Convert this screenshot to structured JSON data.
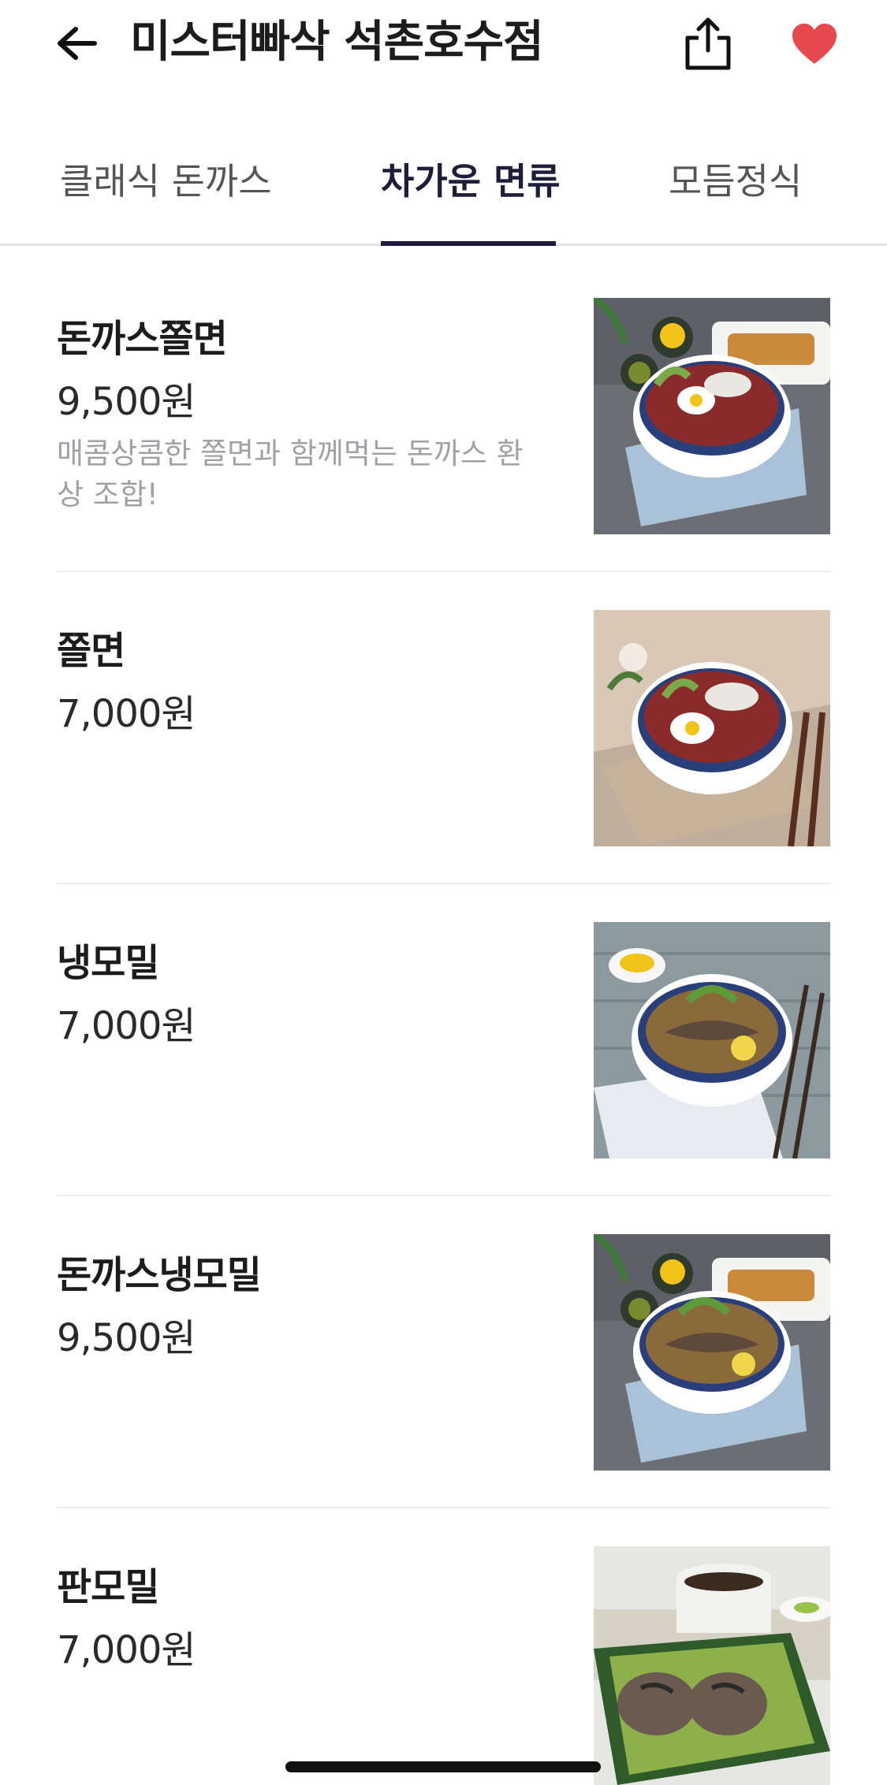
{
  "header": {
    "title": "미스터빠삭 석촌호수점",
    "back_icon": "arrow-left-icon",
    "share_icon": "share-icon",
    "favorite_icon": "heart-icon",
    "favorite_color": "#e5484d"
  },
  "tabs": [
    {
      "label": "클래식 돈까스",
      "active": false
    },
    {
      "label": "차가운 면류",
      "active": true
    },
    {
      "label": "모듬정식",
      "active": false
    }
  ],
  "menu_items": [
    {
      "name": "돈까스쫄면",
      "price": "9,500원",
      "description": "매콤상콤한 쫄면과 함께먹는 돈까스 환상 조합!",
      "image": "tonkatsu-jjolmyeon-photo"
    },
    {
      "name": "쫄면",
      "price": "7,000원",
      "description": "",
      "image": "jjolmyeon-photo"
    },
    {
      "name": "냉모밀",
      "price": "7,000원",
      "description": "",
      "image": "cold-soba-photo"
    },
    {
      "name": "돈까스냉모밀",
      "price": "9,500원",
      "description": "",
      "image": "tonkatsu-cold-soba-photo"
    },
    {
      "name": "판모밀",
      "price": "7,000원",
      "description": "",
      "image": "pan-soba-photo"
    }
  ],
  "colors": {
    "active_tab": "#1e1a3c",
    "description_text": "#a0a0a8",
    "divider": "#ececec"
  }
}
